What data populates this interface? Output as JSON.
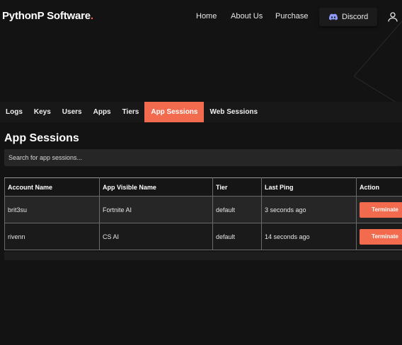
{
  "header": {
    "brand": "PythonP Software",
    "brand_dot": ".",
    "nav": {
      "home": "Home",
      "about": "About Us",
      "purchase": "Purchase"
    },
    "discord_label": "Discord"
  },
  "tabs": [
    "Logs",
    "Keys",
    "Users",
    "Apps",
    "Tiers",
    "App Sessions",
    "Web Sessions"
  ],
  "active_tab": "App Sessions",
  "main": {
    "title": "App Sessions",
    "search_placeholder": "Search for app sessions..."
  },
  "table": {
    "columns": [
      "Account Name",
      "App Visible Name",
      "Tier",
      "Last Ping",
      "Action"
    ],
    "rows": [
      {
        "account": "brit3su",
        "app": "Fortnite AI",
        "tier": "default",
        "last_ping": "3 seconds ago",
        "action": "Terminate"
      },
      {
        "account": "rivenn",
        "app": "CS AI",
        "tier": "default",
        "last_ping": "14 seconds ago",
        "action": "Terminate"
      }
    ]
  },
  "colors": {
    "accent": "#f26b4f",
    "background": "#131313"
  }
}
